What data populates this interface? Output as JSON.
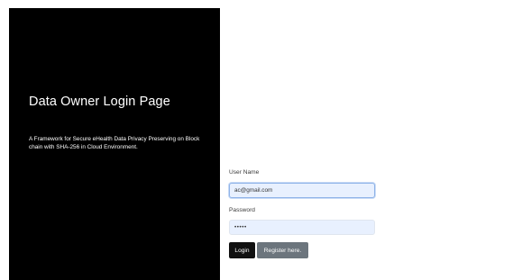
{
  "left_panel": {
    "title": "Data Owner Login Page",
    "description": "A Framework for Secure eHealth Data Privacy Preserving on Block chain with SHA-256 in Cloud Environment."
  },
  "login_form": {
    "username_label": "User Name",
    "username_value": "ac@gmail.com",
    "password_label": "Password",
    "password_value": "•••••",
    "login_button": "Login",
    "register_button": "Register here."
  },
  "colors": {
    "panel_background": "#000000",
    "login_button": "#111111",
    "register_button": "#6c757d",
    "autofill_field": "#e8f0fe"
  }
}
